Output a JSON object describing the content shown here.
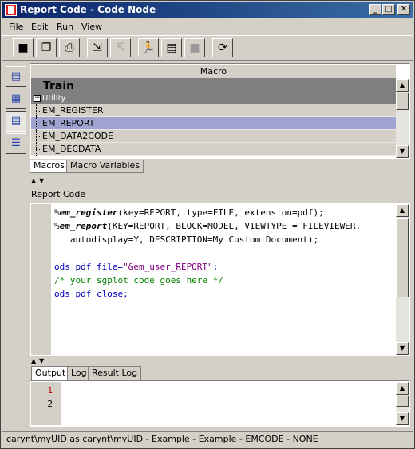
{
  "window": {
    "title": "Report Code - Code Node"
  },
  "menu": [
    "File",
    "Edit",
    "Run",
    "View"
  ],
  "toolbar": {
    "icons": [
      "save-icon",
      "copy-icon",
      "print-icon",
      "import-icon",
      "export-icon",
      "run-icon",
      "submit-icon",
      "stop-icon",
      "refresh-icon"
    ]
  },
  "macros_panel": {
    "column_header": "Macro",
    "group": "Train",
    "subgroup": "Utility",
    "items": [
      "EM_REGISTER",
      "EM_REPORT",
      "EM_DATA2CODE",
      "EM_DECDATA"
    ],
    "selected_index": 1,
    "tabs": [
      "Macros",
      "Macro Variables"
    ],
    "active_tab": 0
  },
  "report_code": {
    "label": "Report Code",
    "lines": [
      {
        "segments": [
          {
            "t": "%",
            "c": ""
          },
          {
            "t": "em_register",
            "c": "mac"
          },
          {
            "t": "(key=REPORT, type=FILE, extension=pdf);",
            "c": ""
          }
        ]
      },
      {
        "segments": [
          {
            "t": "%",
            "c": ""
          },
          {
            "t": "em_report",
            "c": "mac"
          },
          {
            "t": "(KEY=REPORT, BLOCK=MODEL, VIEWTYPE = FILEVIEWER,",
            "c": ""
          }
        ]
      },
      {
        "segments": [
          {
            "t": "   autodisplay=Y, DESCRIPTION=My Custom Document);",
            "c": ""
          }
        ]
      },
      {
        "segments": [
          {
            "t": "",
            "c": ""
          }
        ]
      },
      {
        "segments": [
          {
            "t": "ods pdf file=",
            "c": "kw"
          },
          {
            "t": "\"&em_user_REPORT\"",
            "c": "str"
          },
          {
            "t": ";",
            "c": "kw"
          }
        ]
      },
      {
        "segments": [
          {
            "t": "/* your sgplot code goes here */",
            "c": "cmt"
          }
        ]
      },
      {
        "segments": [
          {
            "t": "ods pdf close;",
            "c": "kw"
          }
        ]
      }
    ]
  },
  "output_panel": {
    "tabs": [
      "Output",
      "Log",
      "Result Log"
    ],
    "active_tab": 0,
    "line_numbers": [
      "1",
      "2"
    ]
  },
  "status": "carynt\\myUID as carynt\\myUID - Example - Example - EMCODE - NONE",
  "colors": {
    "title_start": "#0a246a",
    "title_end": "#3a6ea5",
    "selected_row": "#9ea3d0",
    "keyword": "#0000c0",
    "string": "#800080",
    "comment": "#008000",
    "line_number_first": "#c00000"
  }
}
